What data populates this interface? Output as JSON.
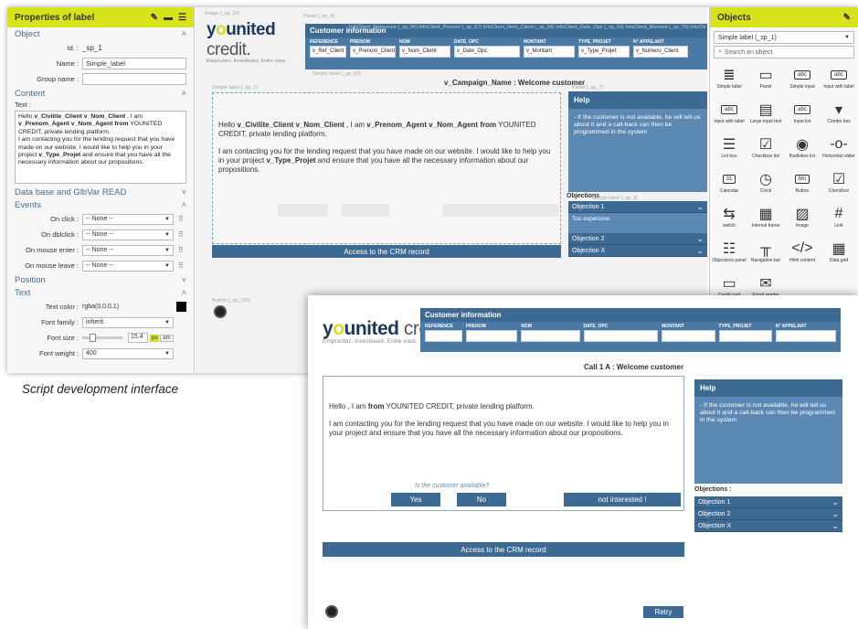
{
  "props": {
    "title": "Properties of label",
    "sections": {
      "object": "Object",
      "content": "Content",
      "database": "Data base and GlbVar READ",
      "events": "Events",
      "position": "Position",
      "text": "Text"
    },
    "fields": {
      "id_label": "Id. :",
      "id_value": "_sp_1",
      "name_label": "Name :",
      "name_value": "Simple_label",
      "group_label": "Group name :",
      "group_value": "",
      "text_label": "Text :"
    },
    "content_text": {
      "line1a": "Hello ",
      "line1b": "v_Civilite_Client v_Nom_Client",
      "line1c": " , I am ",
      "line1d": "v_Prenom_Agent v_Nom_Agent from",
      "line1e": " YOUNITED CREDIT, private lending platform.",
      "line2a": "I am contacting you for the lending request that you have made on our website. I would like to help you in your project ",
      "line2b": "v_Type_Projet",
      "line2c": " and ensure that you have all the necessary information about our propositions."
    },
    "events": [
      {
        "label": "On click :",
        "value": "-- None --"
      },
      {
        "label": "On dblclick :",
        "value": "-- None --"
      },
      {
        "label": "On mouse enter :",
        "value": "-- None --"
      },
      {
        "label": "On mouse leave :",
        "value": "-- None --"
      }
    ],
    "text_props": {
      "color_label": "Text color :",
      "color_value": "rgba(0,0,0,1)",
      "family_label": "Font family :",
      "family_value": "inherit",
      "size_label": "Font size :",
      "size_value": "15.4",
      "size_unit": "px",
      "size_unit2": "em",
      "weight_label": "Font weight :",
      "weight_value": "400"
    }
  },
  "canvas": {
    "image_label": "Image (_sp_20)",
    "panel_label": "Panel (_sp_4)",
    "simple_label_63": "Simple label (_sp_63)",
    "simple_label_1": "Simple label (_sp_1)",
    "panel_label_7": "Panel (_sp_7)",
    "button_label": "Button (_sp_220)",
    "panel_label_9": "Simple label (_sp_9)",
    "field_headers_ghost": "InfoClient_Reference (_sp_66) InfoClient_Prenom (_sp_67) InfoClient_Nom_Client (_sp_68) InfoClient_Date_Opc (_sp_69) InfoClient_Montant (_sp_70) InfoClient_Type_Projet (_sp_71) InfoClient_N_Appelant (_sp_72)",
    "campaign": "v_Campaign_Name : Welcome customer",
    "fields": [
      {
        "header": "REFERENCE",
        "value": "v_Ref_Client"
      },
      {
        "header": "PRENOM",
        "value": "v_Prenom_Client"
      },
      {
        "header": "NOM",
        "value": "v_Nom_Client"
      },
      {
        "header": "DATE_OPC",
        "value": "v_Date_Opc"
      },
      {
        "header": "MONTANT",
        "value": "v_Montant"
      },
      {
        "header": "TYPE_PROJET",
        "value": "v_Type_Projet"
      },
      {
        "header": "N° APPELANT",
        "value": "v_Numero_Client"
      }
    ],
    "objections_label": "Objections",
    "objection_sub": "Too expensive"
  },
  "shared": {
    "logo_main_prefix": "y",
    "logo_main_u": "o",
    "logo_main_rest": "united",
    "logo_credit": " credit.",
    "logo_sub": "Empruntez. Investissez. Entre vous.",
    "customer_info": "Customer information",
    "crm": "Access to the CRM record",
    "help_title": "Help",
    "help_text": "- If the customer is not available, he will tell us about it and a call-back can then be programmed in the system",
    "objections_title": "Objections :",
    "objections": [
      "Objection 1",
      "Objection 2",
      "Objection X"
    ]
  },
  "objects": {
    "title": "Objects",
    "select_value": "Simple label (_sp_1)",
    "search_placeholder": "Search an object",
    "items": [
      {
        "name": "Simple label",
        "icon": "≣"
      },
      {
        "name": "Panel",
        "icon": "▭"
      },
      {
        "name": "Simple input",
        "icon": "abc"
      },
      {
        "name": "Input with label",
        "icon": "abc"
      },
      {
        "name": "Input with label",
        "icon": "abc"
      },
      {
        "name": "Large input text",
        "icon": "▤"
      },
      {
        "name": "Input list",
        "icon": "abc"
      },
      {
        "name": "Combo box",
        "icon": "▾"
      },
      {
        "name": "List box",
        "icon": "☰"
      },
      {
        "name": "Checkbox list",
        "icon": "☑"
      },
      {
        "name": "Radiobox list",
        "icon": "◉"
      },
      {
        "name": "Horizontal slider",
        "icon": "-o-"
      },
      {
        "name": "Calendar",
        "icon": "31"
      },
      {
        "name": "Clock",
        "icon": "◷"
      },
      {
        "name": "Button",
        "icon": "btn"
      },
      {
        "name": "Checkbox",
        "icon": "☑"
      },
      {
        "name": "switch",
        "icon": "⇆"
      },
      {
        "name": "Internal frame",
        "icon": "▦"
      },
      {
        "name": "Image",
        "icon": "▨"
      },
      {
        "name": "Link",
        "icon": "#"
      },
      {
        "name": "Objections panel",
        "icon": "☷"
      },
      {
        "name": "Navigation bar",
        "icon": "╥"
      },
      {
        "name": "Html content",
        "icon": "</>"
      },
      {
        "name": "Data grid",
        "icon": "▦"
      },
      {
        "name": "Credit card",
        "icon": "▭"
      },
      {
        "name": "Email sender",
        "icon": "✉"
      }
    ]
  },
  "caption": "Script development interface",
  "front": {
    "fields": [
      {
        "header": "REFERENCE",
        "value": ""
      },
      {
        "header": "PRENOM",
        "value": ""
      },
      {
        "header": "NOM",
        "value": ""
      },
      {
        "header": "DATE_OPC",
        "value": ""
      },
      {
        "header": "MONTANT",
        "value": ""
      },
      {
        "header": "TYPE_PROJET",
        "value": ""
      },
      {
        "header": "N° APPELANT",
        "value": ""
      }
    ],
    "call_title": "Call 1 A :  Welcome customer",
    "script_line1a": "Hello  , I am  ",
    "script_line1b": "from",
    "script_line1c": " YOUNITED CREDIT, private lending platform.",
    "script_line2": "I am contacting you for the lending request that you have made on our website. I would like to help you in your project  and ensure that you have all the necessary information about our propositions.",
    "availability_q": "Is the customer available?",
    "yes": "Yes",
    "no": "No",
    "not_interested": "not interested !",
    "retry": "Retry"
  },
  "colors": {
    "accent_yellow": "#d8e31c",
    "primary_blue": "#3d6a92",
    "help_blue": "#5b89b3"
  }
}
